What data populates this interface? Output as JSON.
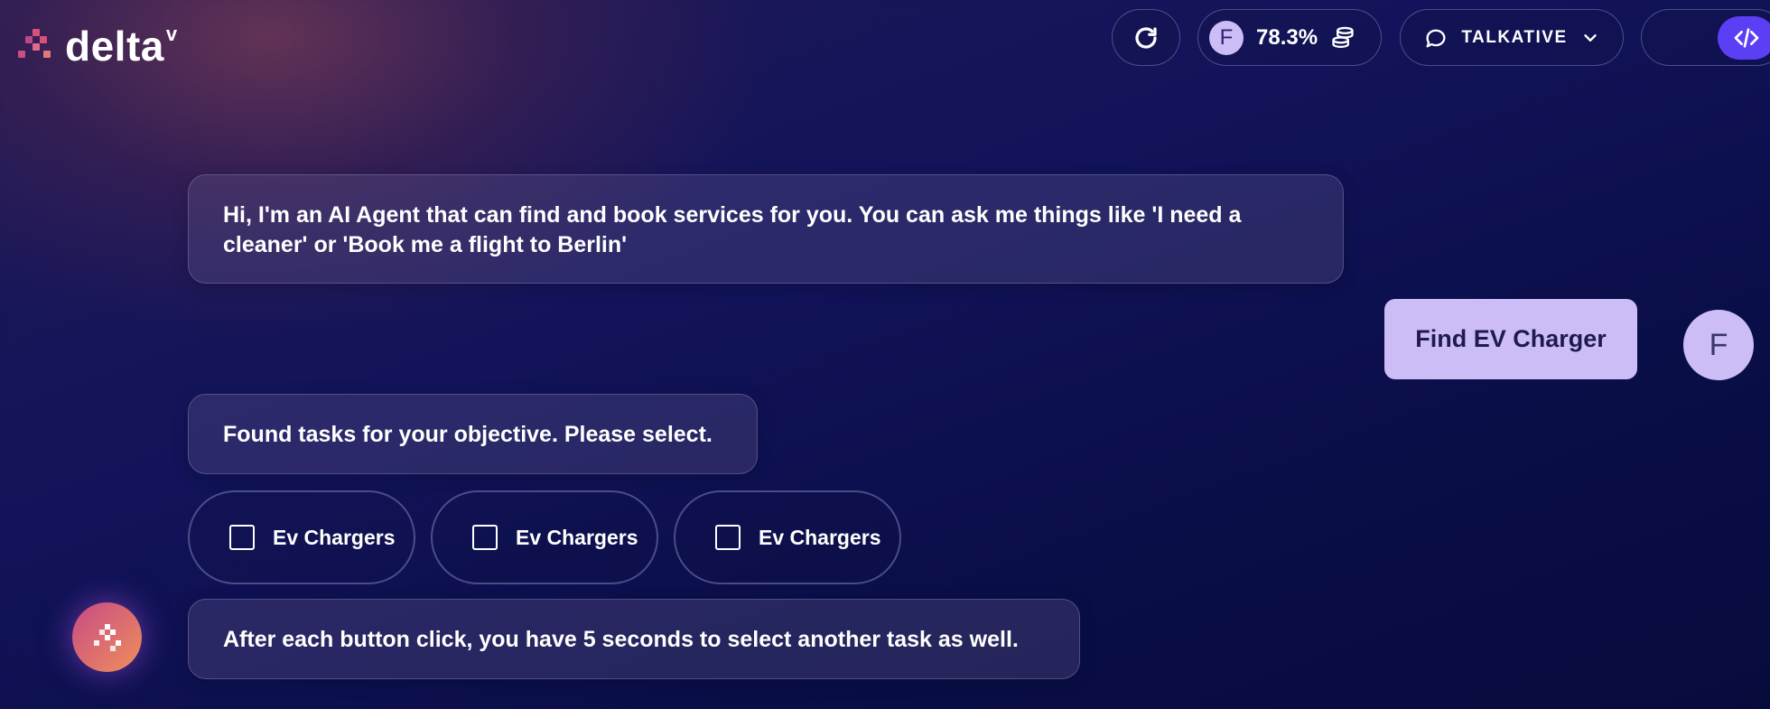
{
  "header": {
    "logo_text": "delta",
    "logo_superscript": "v",
    "credits": {
      "avatar_initial": "F",
      "value": "78.3%"
    },
    "mode": {
      "label": "TALKATIVE"
    }
  },
  "chat": {
    "intro_message": "Hi, I'm an AI Agent that can find and book services for you. You can ask me things like 'I need a cleaner' or 'Book me a flight to Berlin'",
    "user_message": "Find EV Charger",
    "user_avatar_initial": "F",
    "found_message": "Found tasks for your objective. Please select.",
    "task_options": [
      {
        "label": "Ev Chargers",
        "checked": false
      },
      {
        "label": "Ev Chargers",
        "checked": false
      },
      {
        "label": "Ev Chargers",
        "checked": false
      }
    ],
    "after_message": "After each button click, you have 5 seconds to select another task as well."
  },
  "icons": {
    "refresh": "refresh-icon",
    "coins": "coins-icon",
    "chat": "chat-bubble-icon",
    "chevron": "chevron-down-icon",
    "code": "code-icon",
    "assistant": "assistant-logo-icon"
  },
  "colors": {
    "accent": "#5b3ff5",
    "user_bubble": "#cdbdf7",
    "logo_pink": "#d9507a"
  }
}
